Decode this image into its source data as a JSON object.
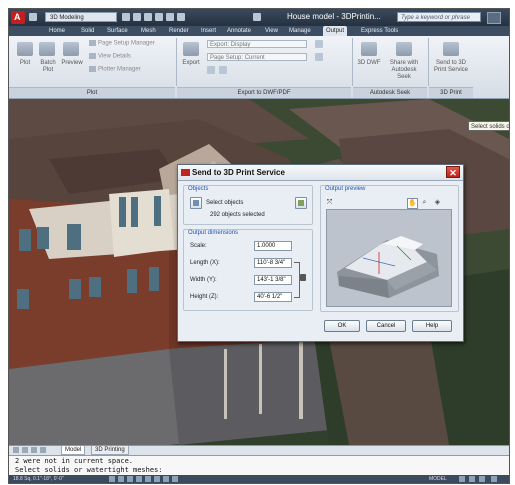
{
  "titlebar": {
    "workspace": "3D Modeling",
    "title": "House model - 3DPrintin...",
    "search_placeholder": "Type a keyword or phrase"
  },
  "ribbon_tabs": [
    "Home",
    "Solid",
    "Surface",
    "Mesh",
    "Render",
    "Insert",
    "Annotate",
    "View",
    "Manage",
    "Output",
    "Express Tools"
  ],
  "active_tab": "Output",
  "ribbon": {
    "plot_panel": {
      "title": "Plot",
      "plot_label": "Plot",
      "batch_plot_label": "Batch Plot",
      "preview_label": "Preview",
      "page_setup_manager": "Page Setup Manager",
      "view_details": "View Details",
      "plotter_manager": "Plotter Manager"
    },
    "export_panel": {
      "title": "Export to DWF/PDF",
      "export_label": "Export",
      "export_combo": "Export: Display",
      "page_setup_combo": "Page Setup: Current"
    },
    "seek_panel": {
      "title": "Autodesk Seek",
      "three_d_dwf": "3D DWF",
      "share_seek": "Share with Autodesk Seek"
    },
    "print_panel": {
      "title": "3D Print",
      "send_to_print": "Send to 3D Print Service"
    }
  },
  "viewport": {
    "tooltip": "Select solids or"
  },
  "layout_tabs": [
    "Model",
    "3D Printing"
  ],
  "command_line": {
    "line1": "2 were not in current space.",
    "line2": "Select solids or watertight meshes:"
  },
  "dialog": {
    "title": "Send to 3D Print Service",
    "objects_group": "Objects",
    "select_objects": "Select objects",
    "selected_count": "292 objects selected",
    "dimensions_group": "Output dimensions",
    "scale_label": "Scale:",
    "scale_value": "1.0000",
    "length_label": "Length (X):",
    "length_value": "110'-8 3/4\"",
    "width_label": "Width (Y):",
    "width_value": "143'-1 3/8\"",
    "height_label": "Height (Z):",
    "height_value": "40'-6 1/2\"",
    "preview_group": "Output preview",
    "ok": "OK",
    "cancel": "Cancel",
    "help": "Help",
    "close_glyph": "✕"
  },
  "statusbar": {
    "coords": "18.8 Sq, 0.1\"-18°, 0'-0\"",
    "model": "MODEL"
  },
  "colors": {
    "ribbon_bg": "#dce3eb",
    "titlebar_bg": "#2f3c4c",
    "dialog_bg": "#e9eef4",
    "accent_red": "#c21f1f"
  }
}
